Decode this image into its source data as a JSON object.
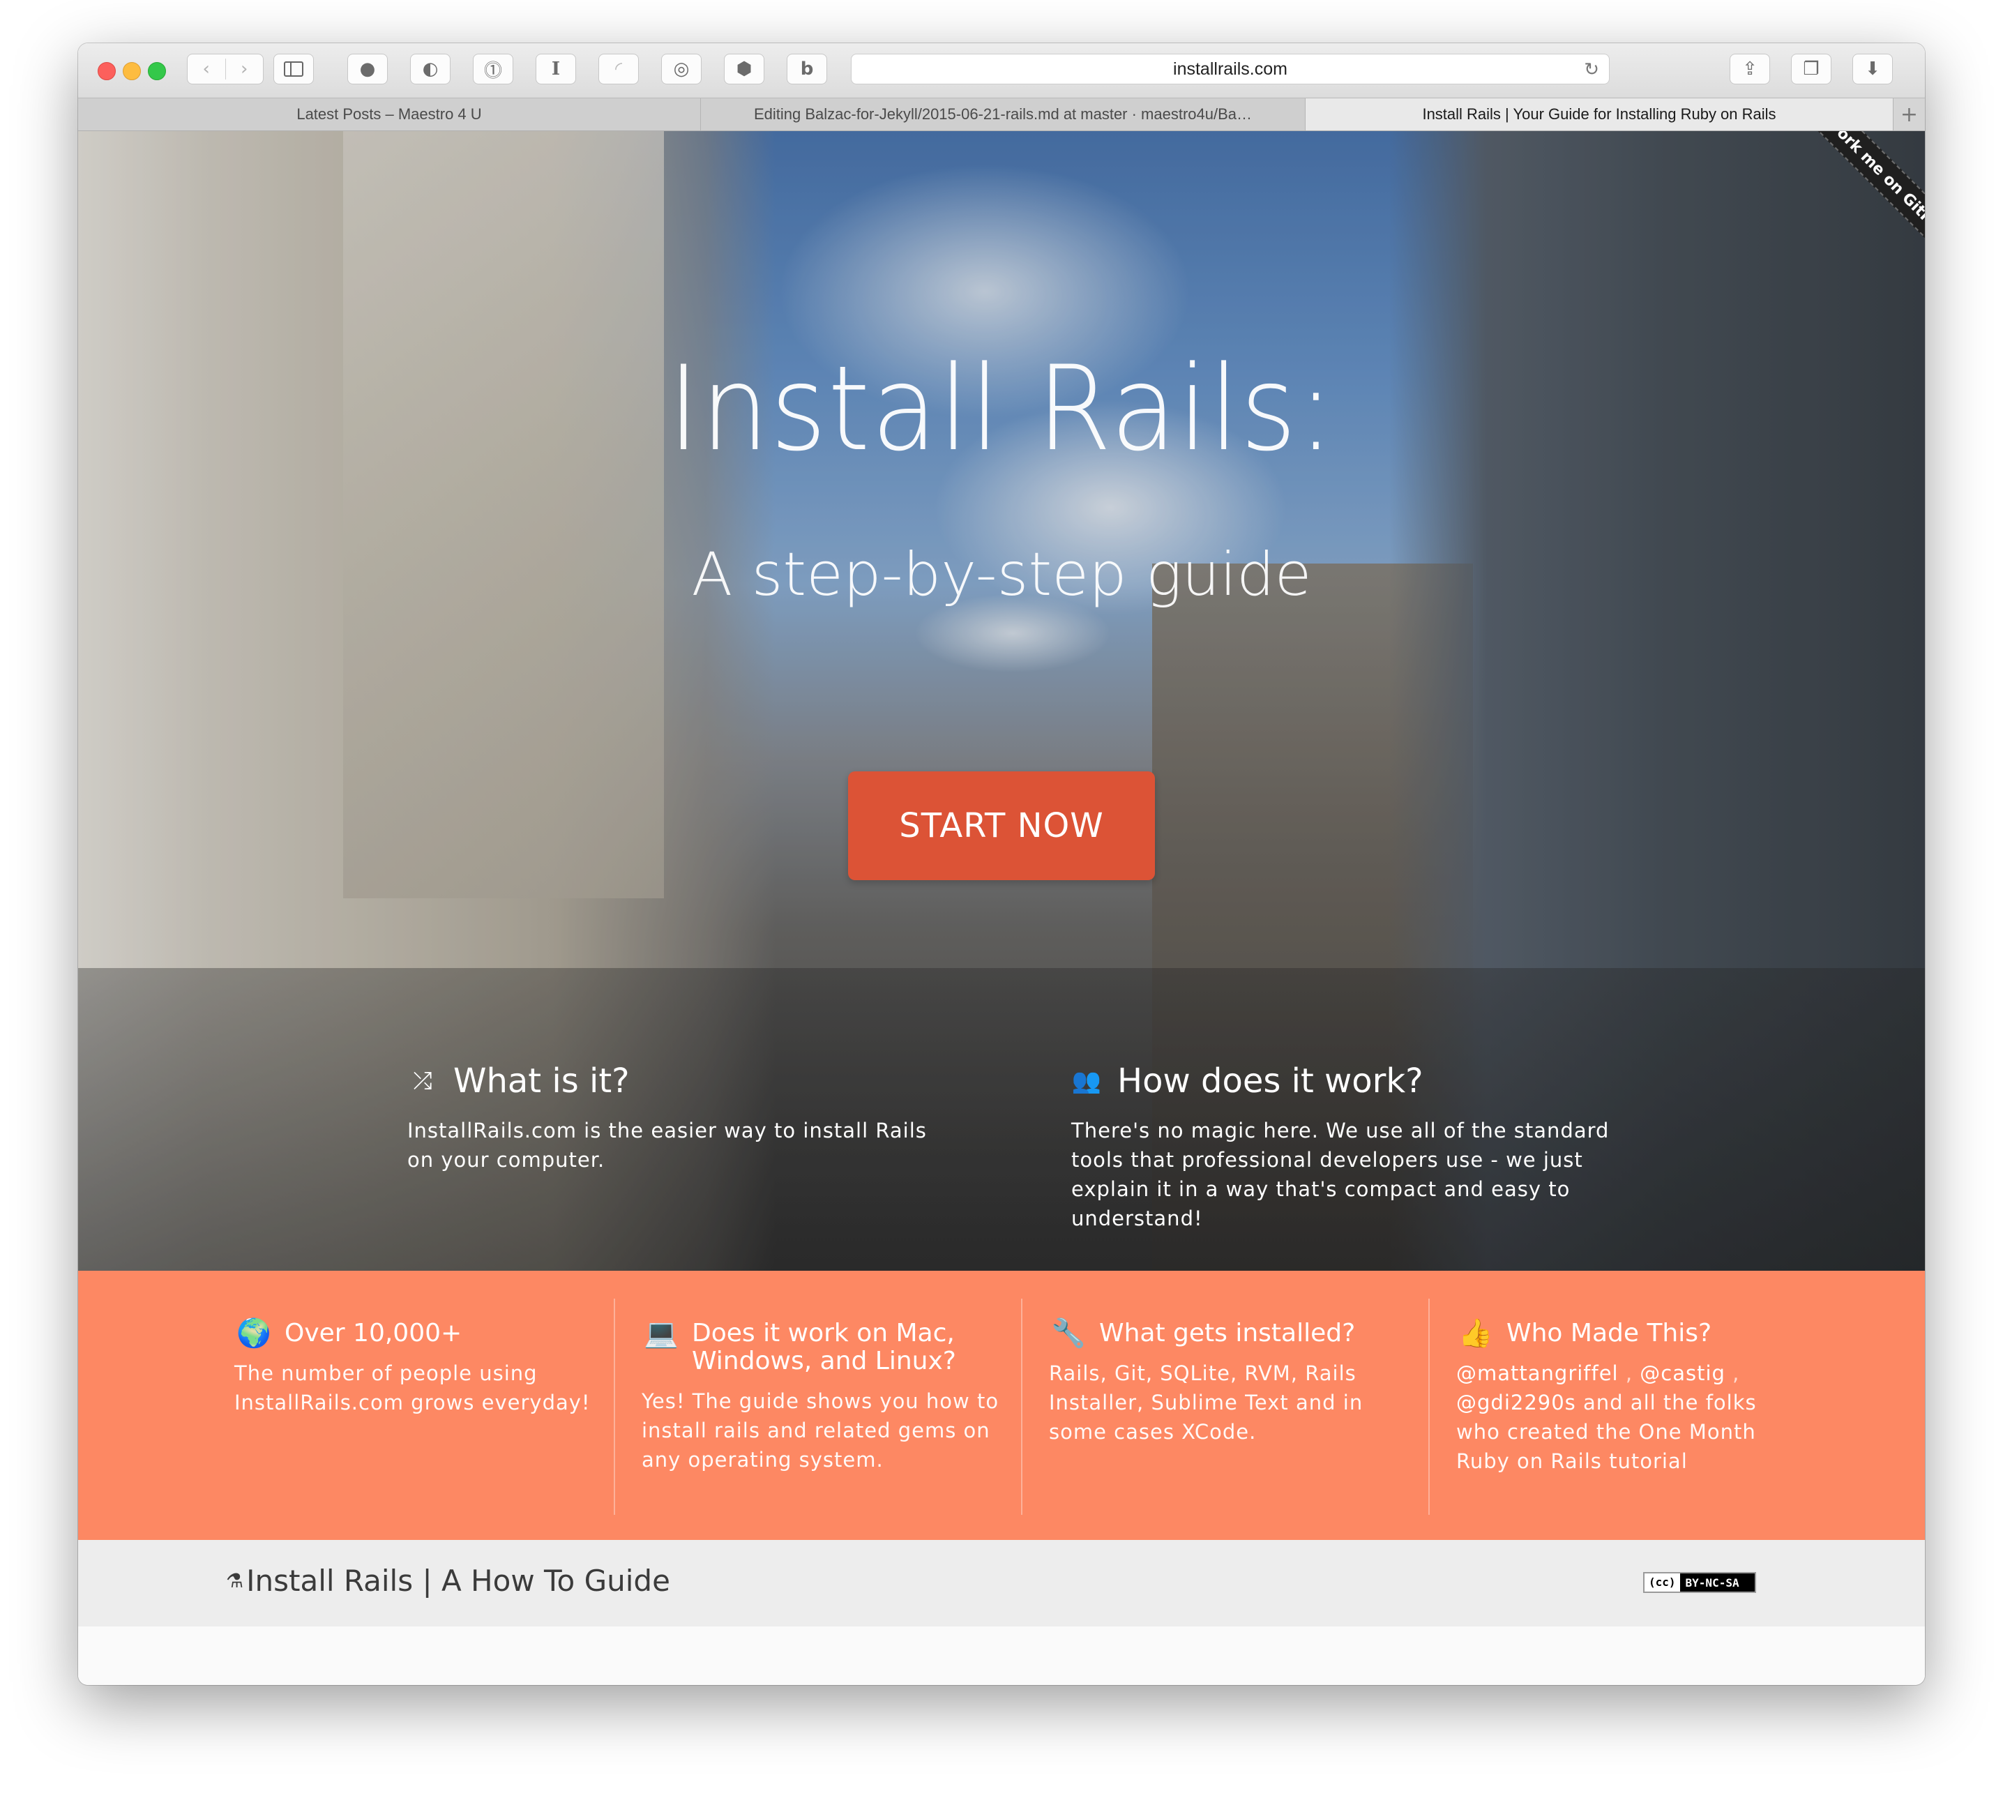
{
  "browser": {
    "url": "installrails.com",
    "tabs": [
      {
        "title": "Latest Posts – Maestro 4 U",
        "active": false
      },
      {
        "title": "Editing Balzac-for-Jekyll/2015-06-21-rails.md at master · maestro4u/Ba…",
        "active": false
      },
      {
        "title": "Install Rails | Your Guide for Installing Ruby on Rails",
        "active": true
      }
    ]
  },
  "hero": {
    "title": "Install Rails:",
    "subtitle": "A step-by-step guide",
    "cta": "START NOW",
    "ribbon": "Fork me on GitHub",
    "what": {
      "heading": "What is it?",
      "text": "InstallRails.com is the easier way to install Rails on your computer."
    },
    "how": {
      "heading": "How does it work?",
      "text": "There's no magic here. We use all of the standard tools that professional developers use - we just explain it in a way that's compact and easy to understand!"
    }
  },
  "features": [
    {
      "heading": "Over 10,000+",
      "text": "The number of people using InstallRails.com grows everyday!"
    },
    {
      "heading": "Does it work on Mac, Windows, and Linux?",
      "text": "Yes! The guide shows you how to install rails and related gems on any operating system."
    },
    {
      "heading": "What gets installed?",
      "text": "Rails, Git, SQLite, RVM, Rails Installer, Sublime Text and in some cases XCode."
    },
    {
      "heading": "Who Made This?",
      "handle1": "@mattangriffel",
      "sep1": ",",
      "handle2": "@castig",
      "sep2": ",",
      "handle3": "@gdi2290s",
      "text": "and all the folks who created the One Month Ruby on Rails tutorial"
    }
  ],
  "footer": {
    "brand": "Install Rails | A How To Guide",
    "license_cc": "(cc)",
    "license": "BY-NC-SA"
  },
  "colors": {
    "cta": "#dc5336",
    "features_bg": "#fd8863",
    "footer_bg": "#ededed"
  },
  "icons": {
    "what": "shuffle-icon",
    "how": "group-icon",
    "f1": "globe-icon",
    "f2": "laptop-icon",
    "f3": "wrench-icon",
    "f4": "thumbs-up-icon"
  }
}
